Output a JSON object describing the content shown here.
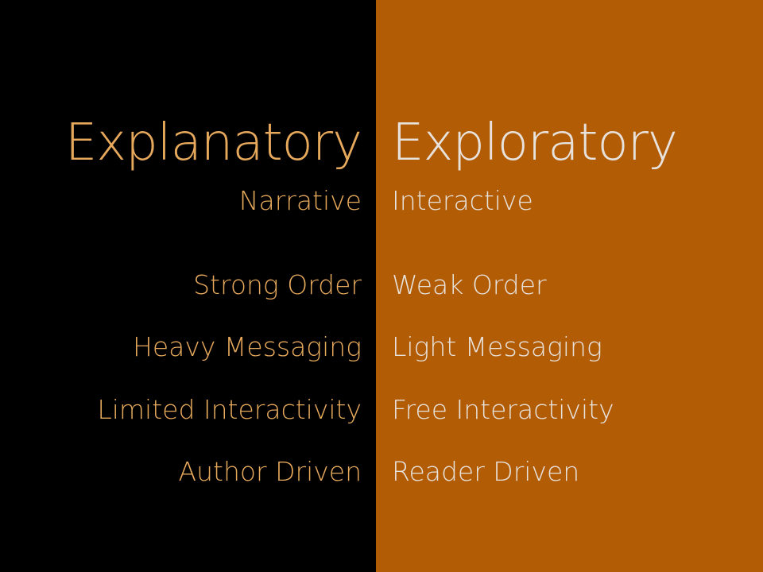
{
  "left": {
    "heading": "Explanatory",
    "subheading": "Narrative",
    "items": [
      "Strong Order",
      "Heavy Messaging",
      "Limited Interactivity",
      "Author Driven"
    ]
  },
  "right": {
    "heading": "Exploratory",
    "subheading": "Interactive",
    "items": [
      "Weak Order",
      "Light Messaging",
      "Free Interactivity",
      "Reader Driven"
    ]
  },
  "colors": {
    "left_background": "#000000",
    "right_background": "#b25d06",
    "left_text": "#e6a95c",
    "right_text": "#e8e2dc"
  }
}
